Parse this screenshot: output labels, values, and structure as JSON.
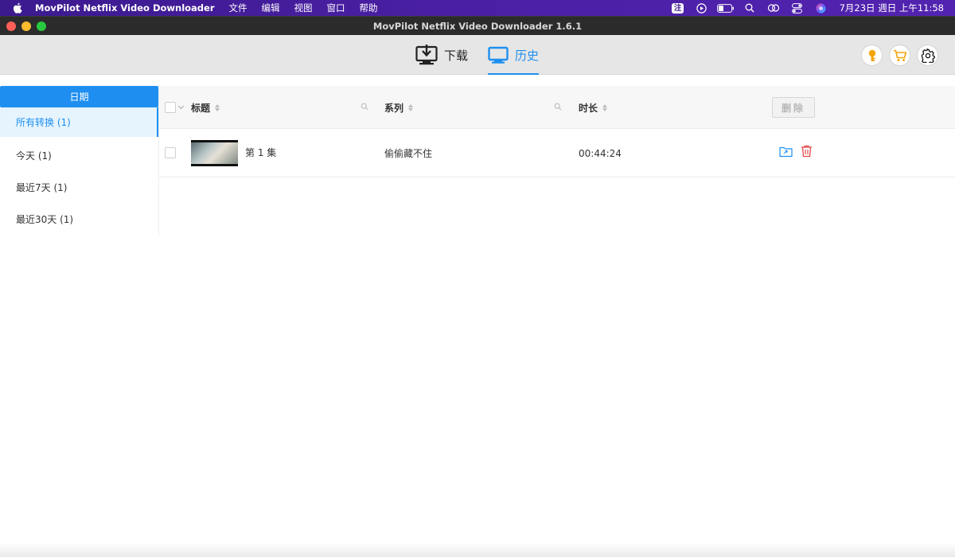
{
  "menubar": {
    "app_name": "MovPilot Netflix Video Downloader",
    "items": [
      "文件",
      "编辑",
      "视图",
      "窗口",
      "帮助"
    ],
    "ime_label": "注",
    "clock": "7月23日 週日 上午11:58"
  },
  "window": {
    "title": "MovPilot Netflix Video Downloader 1.6.1"
  },
  "toolbar": {
    "tabs": [
      {
        "label": "下载",
        "icon": "download-monitor-icon",
        "active": false
      },
      {
        "label": "历史",
        "icon": "monitor-icon",
        "active": true
      }
    ],
    "accent_color": "#1e8ff0"
  },
  "sidebar": {
    "header": "日期",
    "items": [
      {
        "label": "所有转换 (1)",
        "active": true
      },
      {
        "label": "今天 (1)",
        "active": false
      },
      {
        "label": "最近7天 (1)",
        "active": false
      },
      {
        "label": "最近30天 (1)",
        "active": false
      }
    ]
  },
  "table": {
    "columns": {
      "title": "标题",
      "series": "系列",
      "duration": "时长"
    },
    "delete_label": "删除",
    "rows": [
      {
        "title": "第 1 集",
        "series": "偷偷藏不住",
        "duration": "00:44:24"
      }
    ]
  }
}
